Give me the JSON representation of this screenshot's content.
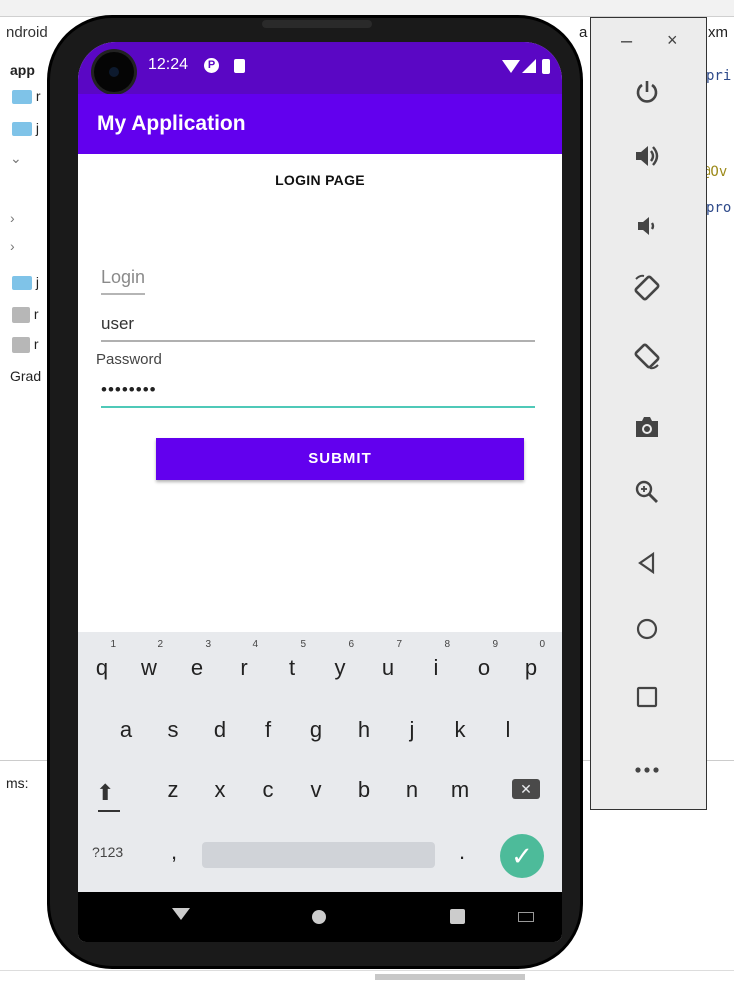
{
  "ide": {
    "left_tab": "ndroid",
    "tree_root": "app",
    "tree_rows": [
      "r",
      "j",
      "j",
      "r",
      "r"
    ],
    "gradle": "Grad",
    "right_tab": "a",
    "right_tab_extra": "xm",
    "code_lines": [
      "pri",
      "@Ov",
      "pro"
    ],
    "bottom_label": "ms:"
  },
  "phone": {
    "status_time": "12:24",
    "app_title": "My Application",
    "page_heading": "LOGIN PAGE",
    "login_label": "Login",
    "username_value": "user",
    "password_label": "Password",
    "password_value": "••••••••",
    "submit_label": "SUBMIT"
  },
  "keyboard": {
    "row1": [
      {
        "key": "q",
        "num": "1"
      },
      {
        "key": "w",
        "num": "2"
      },
      {
        "key": "e",
        "num": "3"
      },
      {
        "key": "r",
        "num": "4"
      },
      {
        "key": "t",
        "num": "5"
      },
      {
        "key": "y",
        "num": "6"
      },
      {
        "key": "u",
        "num": "7"
      },
      {
        "key": "i",
        "num": "8"
      },
      {
        "key": "o",
        "num": "9"
      },
      {
        "key": "p",
        "num": "0"
      }
    ],
    "row2": [
      "a",
      "s",
      "d",
      "f",
      "g",
      "h",
      "j",
      "k",
      "l"
    ],
    "row3": [
      "z",
      "x",
      "c",
      "v",
      "b",
      "n",
      "m"
    ],
    "num_toggle": "?123",
    "comma": ",",
    "period": "."
  },
  "emulator_panel": {
    "minimize": "–",
    "close": "×",
    "buttons": [
      "power-icon",
      "volume-up-icon",
      "volume-down-icon",
      "rotate-left-icon",
      "rotate-right-icon",
      "camera-icon",
      "zoom-icon",
      "back-icon",
      "home-icon",
      "overview-icon",
      "more-icon"
    ]
  },
  "colors": {
    "primary": "#6200ee",
    "status_bar": "#5a07c4",
    "accent": "#4fc9b8"
  }
}
